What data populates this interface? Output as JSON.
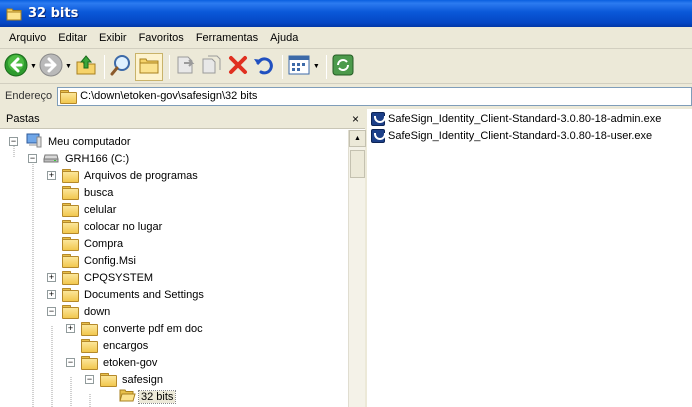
{
  "window": {
    "title": "32 bits"
  },
  "menubar": {
    "items": [
      "Arquivo",
      "Editar",
      "Exibir",
      "Favoritos",
      "Ferramentas",
      "Ajuda"
    ]
  },
  "toolbar": {
    "buttons": [
      "back-icon",
      "forward-icon",
      "up-folder-icon",
      "search-icon",
      "folders-icon",
      "move-to-icon",
      "copy-to-icon",
      "delete-icon",
      "undo-icon",
      "views-icon",
      "sync-icon"
    ]
  },
  "address": {
    "label": "Endereço",
    "value": "C:\\down\\etoken-gov\\safesign\\32 bits"
  },
  "folders_pane": {
    "title": "Pastas",
    "close": "×",
    "tree": [
      {
        "label": "Meu computador",
        "expander": "−",
        "icon": "computer-icon"
      },
      {
        "label": "GRH166 (C:)",
        "expander": "−",
        "icon": "drive-icon"
      },
      {
        "label": "Arquivos de programas",
        "expander": "+",
        "icon": "folder-icon"
      },
      {
        "label": "busca",
        "expander": "",
        "icon": "folder-icon"
      },
      {
        "label": "celular",
        "expander": "",
        "icon": "folder-icon"
      },
      {
        "label": "colocar no lugar",
        "expander": "",
        "icon": "folder-icon"
      },
      {
        "label": "Compra",
        "expander": "",
        "icon": "folder-icon"
      },
      {
        "label": "Config.Msi",
        "expander": "",
        "icon": "folder-icon"
      },
      {
        "label": "CPQSYSTEM",
        "expander": "+",
        "icon": "folder-icon"
      },
      {
        "label": "Documents and Settings",
        "expander": "+",
        "icon": "folder-icon"
      },
      {
        "label": "down",
        "expander": "−",
        "icon": "folder-icon"
      },
      {
        "label": "converte pdf em doc",
        "expander": "+",
        "icon": "folder-icon"
      },
      {
        "label": "encargos",
        "expander": "",
        "icon": "folder-icon"
      },
      {
        "label": "etoken-gov",
        "expander": "−",
        "icon": "folder-icon"
      },
      {
        "label": "safesign",
        "expander": "−",
        "icon": "folder-icon"
      },
      {
        "label": "32 bits",
        "expander": "",
        "icon": "open-folder-icon"
      }
    ]
  },
  "files": [
    {
      "name": "SafeSign_Identity_Client-Standard-3.0.80-18-admin.exe",
      "icon": "safesign-exe-icon"
    },
    {
      "name": "SafeSign_Identity_Client-Standard-3.0.80-18-user.exe",
      "icon": "safesign-exe-icon"
    }
  ]
}
